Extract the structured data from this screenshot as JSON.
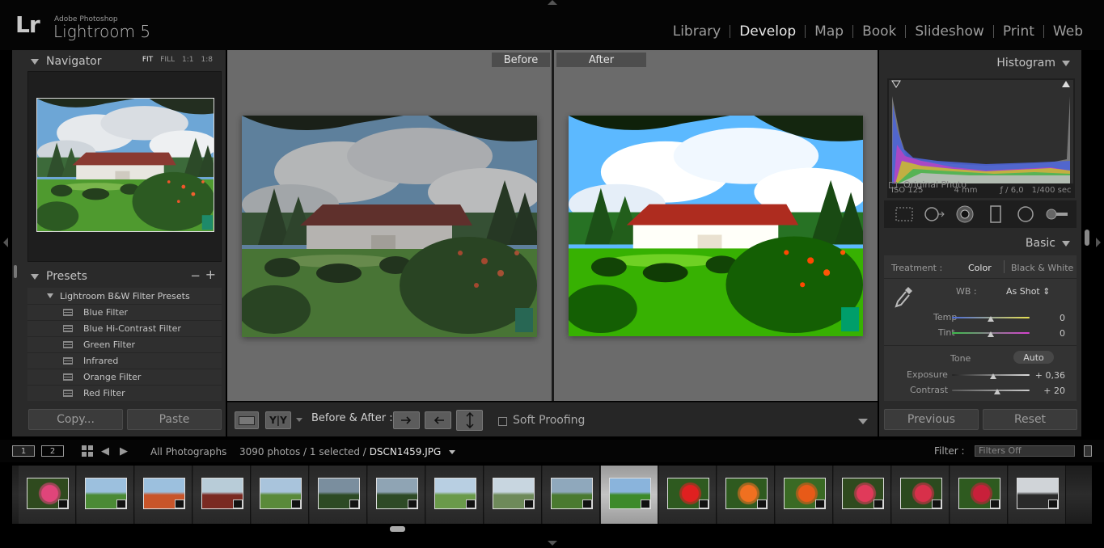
{
  "app": {
    "logo": "Lr",
    "vendor": "Adobe Photoshop",
    "name": "Lightroom 5"
  },
  "modules": [
    {
      "label": "Library",
      "active": false
    },
    {
      "label": "Develop",
      "active": true
    },
    {
      "label": "Map",
      "active": false
    },
    {
      "label": "Book",
      "active": false
    },
    {
      "label": "Slideshow",
      "active": false
    },
    {
      "label": "Print",
      "active": false
    },
    {
      "label": "Web",
      "active": false
    }
  ],
  "navigator": {
    "title": "Navigator",
    "zoom": [
      "FIT",
      "FILL",
      "1:1",
      "1:8"
    ]
  },
  "presets": {
    "title": "Presets",
    "minus": "−",
    "plus": "+",
    "folder": "Lightroom B&W Filter Presets",
    "items": [
      "Blue Filter",
      "Blue Hi-Contrast Filter",
      "Green Filter",
      "Infrared",
      "Orange Filter",
      "Red Filter"
    ]
  },
  "left_buttons": {
    "copy": "Copy...",
    "paste": "Paste"
  },
  "view": {
    "before": "Before",
    "after": "After"
  },
  "toolbar": {
    "yy": "Y|Y",
    "before_after_label": "Before & After :",
    "soft_proofing": "Soft Proofing"
  },
  "histogram": {
    "title": "Histogram",
    "iso": "ISO 125",
    "focal": "4 mm",
    "aperture": "ƒ / 6,0",
    "shutter": "1/400 sec",
    "original_photo": "Original Photo"
  },
  "basic": {
    "title": "Basic",
    "treatment_label": "Treatment :",
    "treatment_color": "Color",
    "treatment_bw": "Black & White",
    "wb_label": "WB :",
    "wb_value": "As Shot ⇕",
    "temp_label": "Temp",
    "temp_value": "0",
    "tint_label": "Tint",
    "tint_value": "0",
    "tone_label": "Tone",
    "auto": "Auto",
    "exposure_label": "Exposure",
    "exposure_value": "+ 0,36",
    "contrast_label": "Contrast",
    "contrast_value": "+ 20"
  },
  "right_buttons": {
    "previous": "Previous",
    "reset": "Reset"
  },
  "infobar": {
    "monitor1": "1",
    "monitor2": "2",
    "source": "All Photographs",
    "count": "3090 photos / 1 selected /",
    "file": "DSCN1459.JPG",
    "filter_label": "Filter :",
    "filter_value": "Filters Off"
  },
  "filmstrip": {
    "thumbs": [
      "flower-pink",
      "park",
      "garden",
      "house-red",
      "garden-path",
      "forest",
      "forest-tree",
      "field-sky",
      "lake",
      "grass-hill",
      "house-garden",
      "flower-red",
      "flower-orange",
      "flower-orange-2",
      "flower-pink-2",
      "flower-red-white",
      "flower-red-2",
      "building-white"
    ],
    "selected_index": 10
  },
  "colors": {
    "accent_active": "#e9e9e9",
    "panel_bg": "#2a2a2a",
    "canvas_bg": "#6b6b6b"
  }
}
